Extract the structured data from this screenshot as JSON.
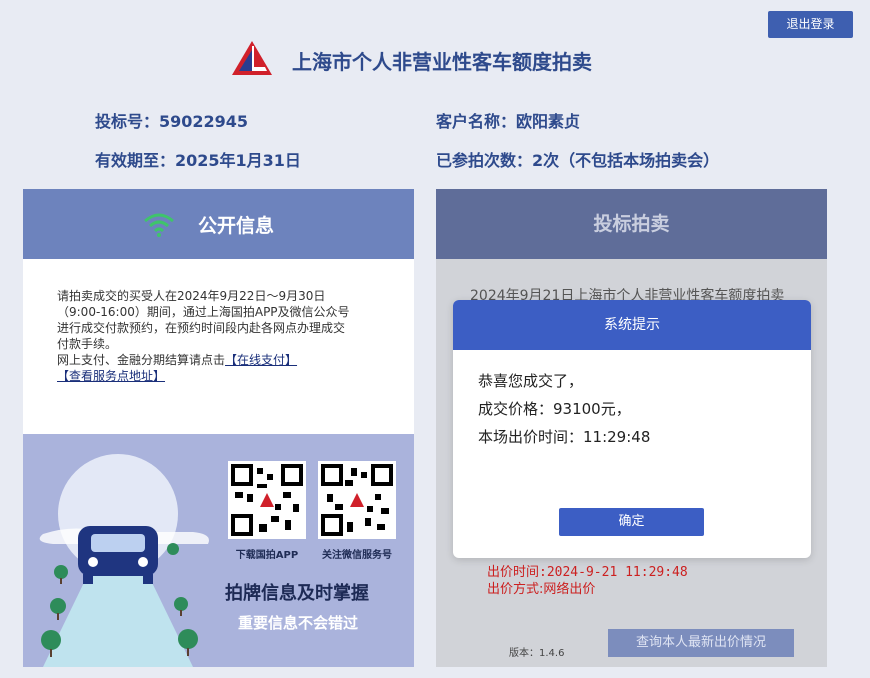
{
  "header": {
    "title": "上海市个人非营业性客车额度拍卖",
    "logout": "退出登录"
  },
  "info": {
    "bid_no": "投标号：59022945",
    "customer": "客户名称：欧阳素贞",
    "valid_until": "有效期至：2025年1月31日",
    "participations": "已参拍次数：2次（不包括本场拍卖会）"
  },
  "left_card": {
    "title": "公开信息",
    "notice_line1": "请拍卖成交的买受人在2024年9月22日～9月30日",
    "notice_line2": "（9:00-16:00）期间，通过上海国拍APP及微信公众号",
    "notice_line3": "进行成交付款预约，在预约时间段内赴各网点办理成交",
    "notice_line4": "付款手续。",
    "notice_line5": "网上支付、金融分期结算请点击",
    "link_pay": "【在线支付】",
    "link_service": "【查看服务点地址】",
    "qr_app_label": "下载国拍APP",
    "qr_wechat_label": "关注微信服务号",
    "promo_main": "拍牌信息及时掌握",
    "promo_sub": "重要信息不会错过"
  },
  "right_card": {
    "title": "投标拍卖",
    "bg_auction": "2024年9月21日上海市个人非营业性客车额度拍卖",
    "bid_time": "出价时间:2024-9-21 11:29:48",
    "bid_method": "出价方式:网络出价",
    "version": "版本：1.4.6",
    "query_button": "查询本人最新出价情况"
  },
  "modal": {
    "title": "系统提示",
    "line1": "恭喜您成交了，",
    "line2": "成交价格：93100元，",
    "line3": "本场出价时间：11:29:48",
    "ok": "确定"
  },
  "colors": {
    "brand_blue": "#3c5ec4",
    "logo_red": "#d0202a",
    "card_header": "#6d83bd"
  }
}
